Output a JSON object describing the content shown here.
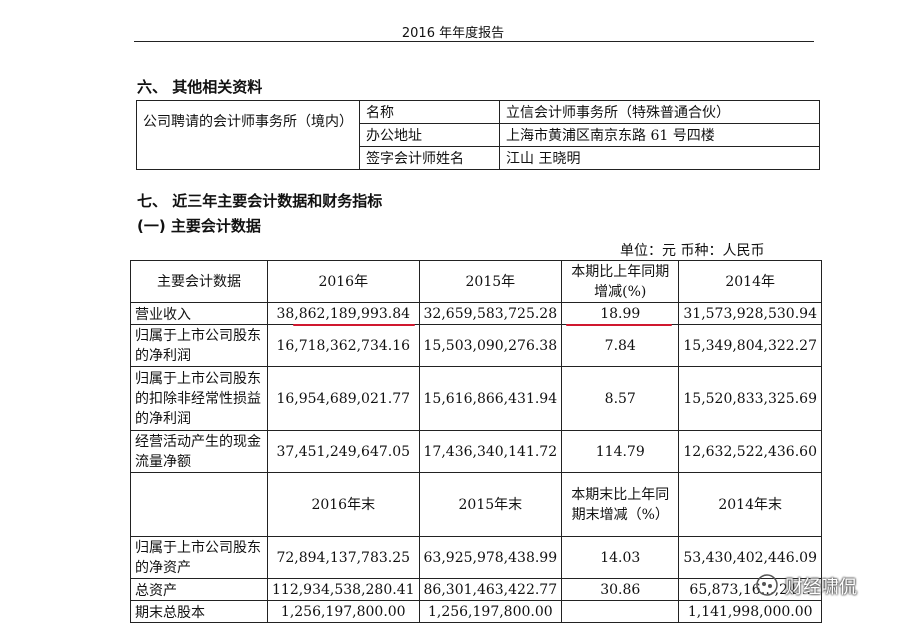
{
  "header": {
    "title": "2016 年年度报告"
  },
  "section6": {
    "title": "六、 其他相关资料"
  },
  "auditor": {
    "label": "公司聘请的会计师事务所（境内）",
    "rows": [
      {
        "key": "名称",
        "value": "立信会计师事务所（特殊普通合伙）"
      },
      {
        "key": "办公地址",
        "value": "上海市黄浦区南京东路  61  号四楼"
      },
      {
        "key": "签字会计师姓名",
        "value": "江山  王晓明"
      }
    ]
  },
  "section7": {
    "title": "七、 近三年主要会计数据和财务指标",
    "subtitle": "(一) 主要会计数据"
  },
  "unit_line": "单位：元    币种：人民币",
  "table": {
    "header1": [
      "主要会计数据",
      "2016年",
      "2015年",
      "本期比上年同期增减(%)",
      "2014年"
    ],
    "rows1": [
      [
        "营业收入",
        "38,862,189,993.84",
        "32,659,583,725.28",
        "18.99",
        "31,573,928,530.94"
      ],
      [
        "归属于上市公司股东的净利润",
        "16,718,362,734.16",
        "15,503,090,276.38",
        "7.84",
        "15,349,804,322.27"
      ],
      [
        "归属于上市公司股东的扣除非经常性损益的净利润",
        "16,954,689,021.77",
        "15,616,866,431.94",
        "8.57",
        "15,520,833,325.69"
      ],
      [
        "经营活动产生的现金流量净额",
        "37,451,249,647.05",
        "17,436,340,141.72",
        "114.79",
        "12,632,522,436.60"
      ]
    ],
    "header2": [
      "",
      "2016年末",
      "2015年末",
      "本期末比上年同期末增减（%）",
      "2014年末"
    ],
    "rows2": [
      [
        "归属于上市公司股东的净资产",
        "72,894,137,783.25",
        "63,925,978,438.99",
        "14.03",
        "53,430,402,446.09"
      ],
      [
        "总资产",
        "112,934,538,280.41",
        "86,301,463,422.77",
        "30.86",
        "65,873,16…,24…"
      ],
      [
        "期末总股本",
        "1,256,197,800.00",
        "1,256,197,800.00",
        "",
        "1,141,998,000.00"
      ]
    ]
  },
  "watermark": {
    "text": "财经啸侃",
    "logo_icon": "wechat-official-logo"
  },
  "colors": {
    "highlight_underline": "#d0182f"
  }
}
